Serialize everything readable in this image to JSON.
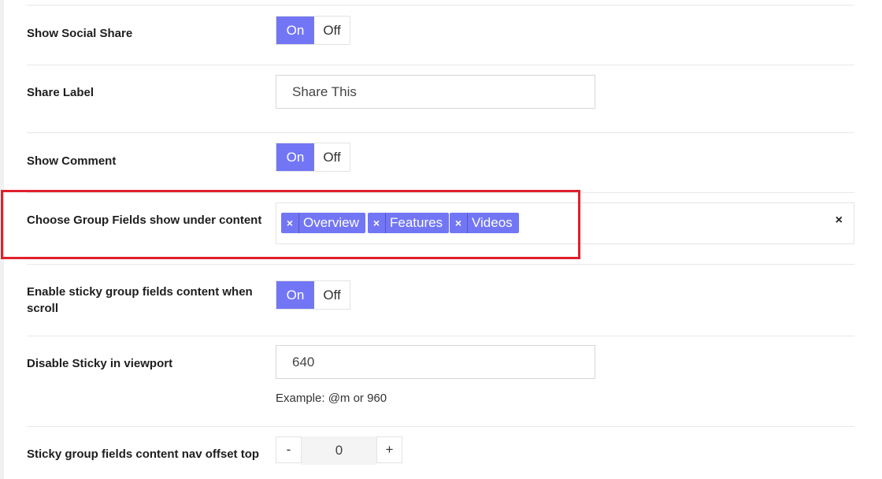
{
  "settings": {
    "show_social_share": {
      "label": "Show Social Share",
      "on": "On",
      "off": "Off",
      "selected": "On"
    },
    "share_label": {
      "label": "Share Label",
      "value": "Share This"
    },
    "show_comment": {
      "label": "Show Comment",
      "on": "On",
      "off": "Off",
      "selected": "On"
    },
    "group_fields": {
      "label": "Choose Group Fields show under content",
      "chips": [
        {
          "text": "Overview",
          "remove": "×"
        },
        {
          "text": "Features",
          "remove": "×"
        },
        {
          "text": "Videos",
          "remove": "×"
        }
      ],
      "clear": "×"
    },
    "sticky_group": {
      "label": "Enable sticky group fields content when scroll",
      "on": "On",
      "off": "Off",
      "selected": "On"
    },
    "disable_sticky": {
      "label": "Disable Sticky in viewport",
      "value": "640",
      "hint": "Example: @m or 960"
    },
    "nav_offset": {
      "label": "Sticky group fields content nav offset top",
      "minus": "-",
      "value": "0",
      "plus": "+"
    }
  },
  "colors": {
    "accent": "#7276f5",
    "highlight": "#e0202b"
  }
}
